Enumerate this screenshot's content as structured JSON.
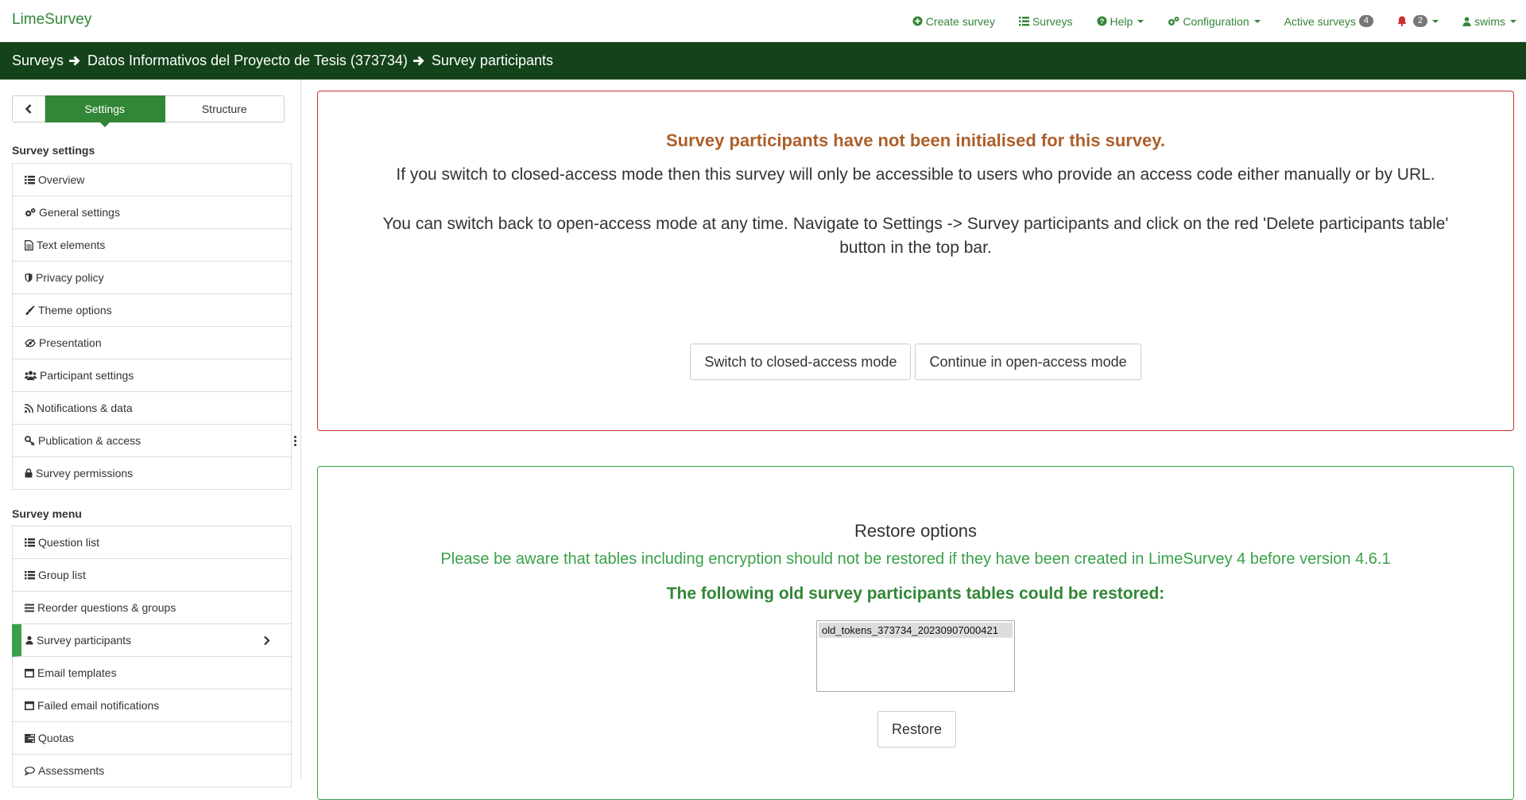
{
  "brand": "LimeSurvey",
  "topnav": {
    "create_survey": "Create survey",
    "surveys": "Surveys",
    "help": "Help",
    "configuration": "Configuration",
    "active_surveys": "Active surveys",
    "active_surveys_count": "4",
    "notifications_count": "2",
    "user": "swims"
  },
  "breadcrumb": {
    "surveys": "Surveys",
    "survey": "Datos Informativos del Proyecto de Tesis (373734)",
    "current": "Survey participants"
  },
  "sidebar": {
    "tabs": {
      "settings": "Settings",
      "structure": "Structure"
    },
    "settings_heading": "Survey settings",
    "settings_items": [
      {
        "label": "Overview"
      },
      {
        "label": "General settings"
      },
      {
        "label": "Text elements"
      },
      {
        "label": "Privacy policy"
      },
      {
        "label": "Theme options"
      },
      {
        "label": "Presentation"
      },
      {
        "label": "Participant settings"
      },
      {
        "label": "Notifications & data"
      },
      {
        "label": "Publication & access"
      },
      {
        "label": "Survey permissions"
      }
    ],
    "menu_heading": "Survey menu",
    "menu_items": [
      {
        "label": "Question list"
      },
      {
        "label": "Group list"
      },
      {
        "label": "Reorder questions & groups"
      },
      {
        "label": "Survey participants"
      },
      {
        "label": "Email templates"
      },
      {
        "label": "Failed email notifications"
      },
      {
        "label": "Quotas"
      },
      {
        "label": "Assessments"
      }
    ]
  },
  "notice": {
    "title": "Survey participants have not been initialised for this survey.",
    "paragraph1": "If you switch to closed-access mode then this survey will only be accessible to users who provide an access code either manually or by URL.",
    "paragraph2": "You can switch back to open-access mode at any time. Navigate to Settings -> Survey participants and click on the red 'Delete participants table' button in the top bar.",
    "switch_button": "Switch to closed-access mode",
    "continue_button": "Continue in open-access mode"
  },
  "restore": {
    "title": "Restore options",
    "warning": "Please be aware that tables including encryption should not be restored if they have been created in LimeSurvey 4 before version 4.6.1",
    "subtitle": "The following old survey participants tables could be restored:",
    "tables": [
      "old_tokens_373734_20230907000421"
    ],
    "restore_button": "Restore"
  },
  "colors": {
    "brand_green": "#328637",
    "breadcrumb_bg": "#14421a",
    "active_green": "#3aa14a",
    "warning_orange": "#ad5f2a",
    "danger_red": "#c9302c"
  }
}
